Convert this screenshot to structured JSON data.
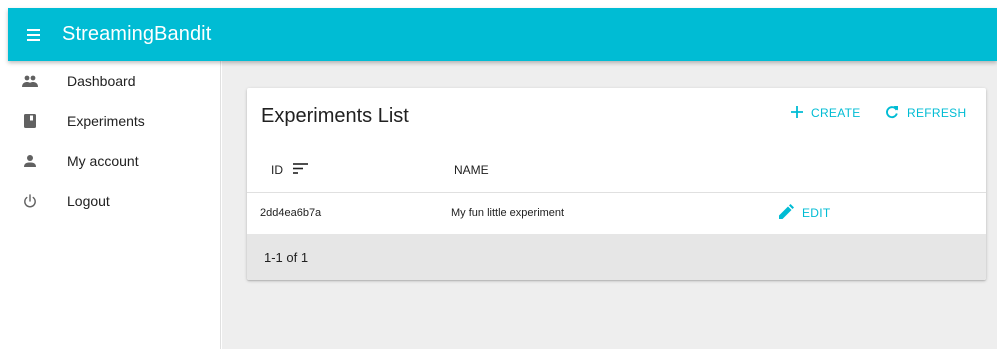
{
  "app": {
    "title": "StreamingBandit"
  },
  "sidebar": {
    "items": [
      {
        "label": "Dashboard",
        "icon": "people-icon"
      },
      {
        "label": "Experiments",
        "icon": "book-icon"
      },
      {
        "label": "My account",
        "icon": "person-icon"
      },
      {
        "label": "Logout",
        "icon": "power-icon"
      }
    ]
  },
  "experiments_list": {
    "title": "Experiments List",
    "create_label": "CREATE",
    "refresh_label": "REFRESH",
    "columns": {
      "id": "ID",
      "name": "NAME"
    },
    "rows": [
      {
        "id": "2dd4ea6b7a",
        "name": "My fun little experiment",
        "edit_label": "EDIT"
      }
    ],
    "pagination": "1-1 of 1"
  },
  "colors": {
    "primary": "#00bcd4",
    "background": "#eeeeee",
    "footer": "#e6e6e6"
  }
}
